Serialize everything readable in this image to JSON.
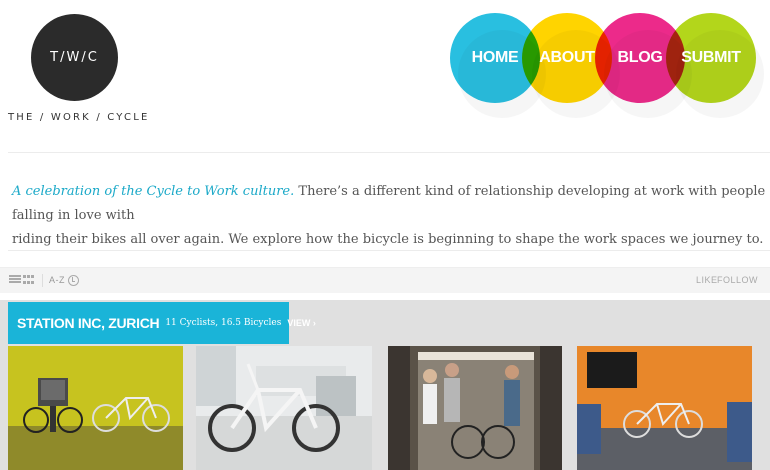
{
  "logo": {
    "mark": "T/W/C",
    "name": "THE / WORK / CYCLE"
  },
  "nav": [
    {
      "label": "HOME",
      "color": "#29bfe0"
    },
    {
      "label": "ABOUT",
      "color": "#ffd400"
    },
    {
      "label": "BLOG",
      "color": "#ec2a8a"
    },
    {
      "label": "SUBMIT",
      "color": "#b3d61b"
    }
  ],
  "intro": {
    "highlight": "A celebration of the Cycle to Work culture.",
    "line1": " There’s a different kind of relationship developing at work with people falling in love with",
    "line2": "riding their bikes all over again. We explore how the bicycle is beginning to shape the work spaces we journey to."
  },
  "toolbar": {
    "sort_az": "A-Z",
    "like": "LIKE",
    "follow": "FOLLOW"
  },
  "station": {
    "title": "STATION INC, ZURICH",
    "meta": "11 Cyclists, 16.5 Bicycles",
    "view": "VIEW ›"
  },
  "photos": [
    {
      "name": "yellow-wall-bike-photo"
    },
    {
      "name": "white-bike-office-photo"
    },
    {
      "name": "elevator-cyclists-photo"
    },
    {
      "name": "orange-room-bike-photo"
    }
  ],
  "colors": {
    "accent": "#1ab4d8",
    "text": "#555555"
  }
}
